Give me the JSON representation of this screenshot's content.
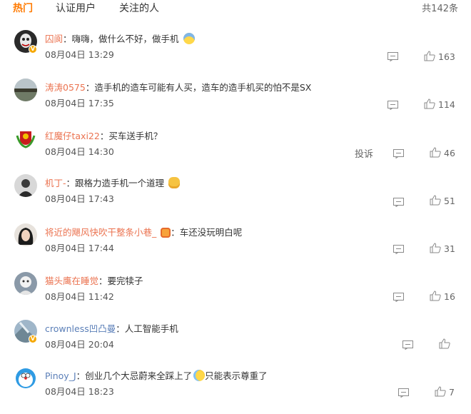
{
  "tabs": {
    "hot": "热门",
    "verified": "认证用户",
    "following": "关注的人"
  },
  "total_label": "共142条",
  "report_label": "投诉",
  "comments": [
    {
      "user": "囚阆",
      "sep": "：",
      "text": "嗨嗨，做什么不好，做手机",
      "time": "08月04日 13:29",
      "likes": "163",
      "emoji": "cold-sweat-emoji",
      "verified": true
    },
    {
      "user": "涛涛0575",
      "sep": "：",
      "text": "造手机的造车可能有人买，造车的造手机买的怕不是SX",
      "time": "08月04日 17:35",
      "likes": "114"
    },
    {
      "user": "红魔仔taxi22",
      "sep": "：",
      "text": "买车送手机？",
      "time": "08月04日 14:30",
      "likes": "46"
    },
    {
      "user": "机丁-",
      "sep": "：",
      "text": "跟格力造手机一个道理",
      "time": "08月04日 17:43",
      "likes": "51",
      "emoji": "cat-emoji"
    },
    {
      "user": "将近的飓风快吹干整条小巷_",
      "sep": "：",
      "text": "车还没玩明白呢",
      "time": "08月04日 17:44",
      "likes": "31",
      "emoji": "badge-emoji"
    },
    {
      "user": "猫头鹰在睡觉",
      "sep": "：",
      "text": "要完犊子",
      "time": "08月04日 11:42",
      "likes": "16"
    },
    {
      "user": "crownless凹凸曼",
      "sep": "：",
      "text": "人工智能手机",
      "time": "08月04日 20:04",
      "likes": ""
    },
    {
      "user": "Pinoy_J",
      "sep": "：",
      "text": "创业几个大忌蔚来全踩上了",
      "text2": "只能表示尊重了",
      "time": "08月04日 18:23",
      "likes": "7",
      "emoji": "laugh-cry-emoji"
    }
  ]
}
